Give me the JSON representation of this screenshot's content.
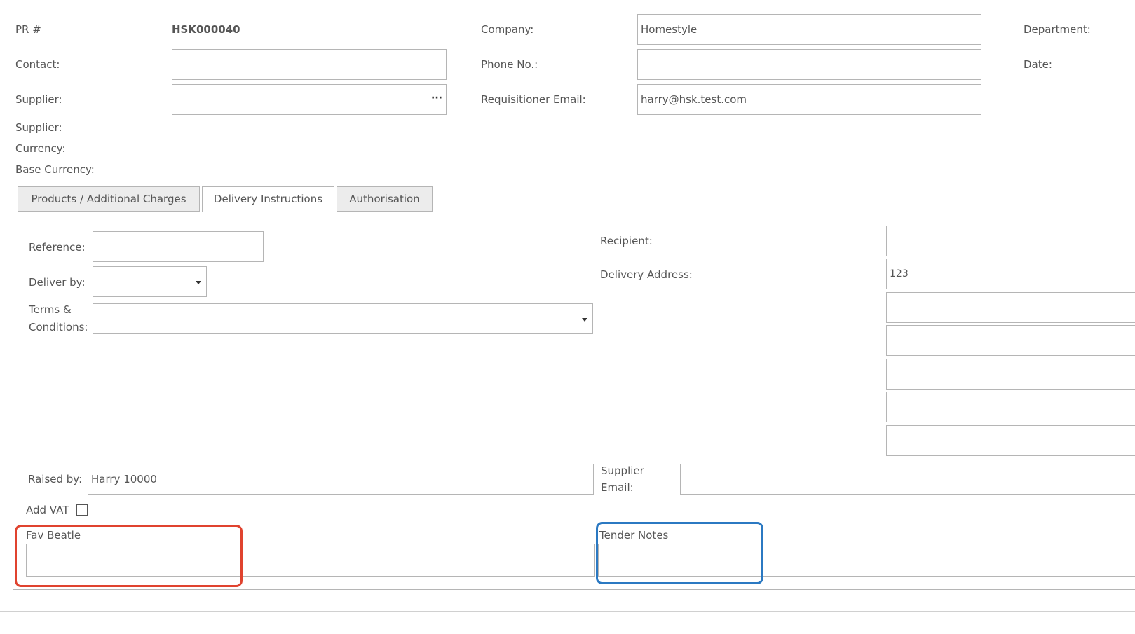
{
  "header": {
    "pr_label": "PR #",
    "pr_value": "HSK000040",
    "company_label": "Company:",
    "company_value": "Homestyle",
    "department_label": "Department:",
    "contact_label": "Contact:",
    "contact_value": "",
    "phone_label": "Phone No.:",
    "phone_value": "",
    "date_label": "Date:",
    "supplier_label": "Supplier:",
    "supplier_value": "",
    "supplier_lookup": "···",
    "requisitioner_email_label": "Requisitioner Email:",
    "requisitioner_email_value": "harry@hsk.test.com",
    "supplier2_label": "Supplier:",
    "currency_label": "Currency:",
    "base_currency_label": "Base Currency:"
  },
  "tabs": [
    {
      "label": "Products / Additional Charges",
      "active": false
    },
    {
      "label": "Delivery Instructions",
      "active": true
    },
    {
      "label": "Authorisation",
      "active": false
    }
  ],
  "delivery": {
    "reference_label": "Reference:",
    "reference_value": "",
    "deliver_by_label": "Deliver by:",
    "deliver_by_value": "",
    "terms_label_line1": "Terms &",
    "terms_label_line2": "Conditions:",
    "terms_value": "",
    "recipient_label": "Recipient:",
    "recipient_value": "",
    "delivery_address_label": "Delivery Address:",
    "address_lines": [
      "123",
      "",
      "",
      "",
      "",
      ""
    ],
    "raised_by_label": "Raised by:",
    "raised_by_value": "Harry 10000",
    "supplier_email_label_line1": "Supplier",
    "supplier_email_label_line2": "Email:",
    "supplier_email_value": "",
    "add_vat_label": "Add VAT",
    "add_vat_checked": false,
    "fav_beatle_label": "Fav Beatle",
    "fav_beatle_value": "",
    "tender_notes_label": "Tender Notes",
    "tender_notes_value": ""
  },
  "colors": {
    "highlight_red": "#e0432f",
    "highlight_blue": "#2b79c2",
    "border": "#b5b5b5",
    "text": "#555555"
  }
}
